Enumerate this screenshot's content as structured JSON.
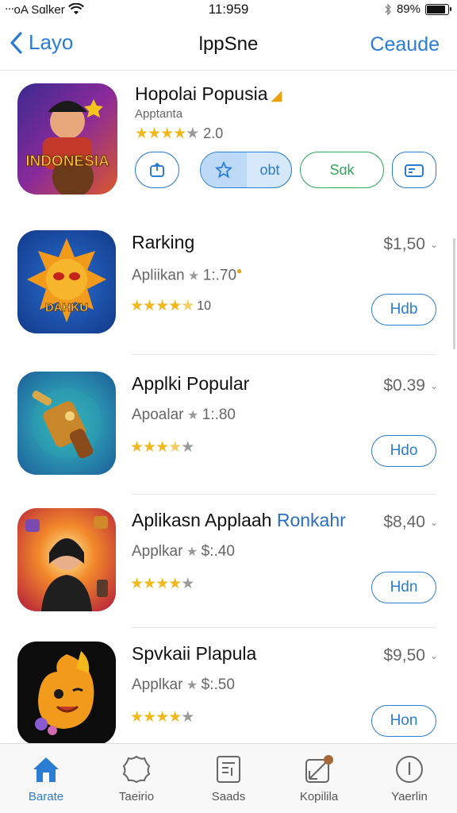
{
  "status_bar": {
    "carrier": "ᐧᐧᐧoA Sɑlker",
    "time": "11:959",
    "battery": "89%",
    "battery_level": 0.89
  },
  "nav": {
    "back_label": "Layo",
    "title": "lppSne",
    "action_label": "Ceaude"
  },
  "featured": {
    "title": "Hopolai Popusia",
    "subtitle": "Apptanta",
    "rating_value": "2.0",
    "stars": 4,
    "icon_text": "INDONESIA",
    "actions": {
      "star_label": "obt",
      "sale_label": "Sɑk"
    }
  },
  "apps": [
    {
      "name": "Rarking",
      "name_accent": "",
      "meta": "Apliikan",
      "meta_value": "1:.70",
      "rating_count": "10",
      "stars": 4.5,
      "price": "$1,50",
      "button_label": "Hdb",
      "icon_text": "DAHKU"
    },
    {
      "name": "Applki Popular",
      "name_accent": "",
      "meta": "Apoalar",
      "meta_value": "1:.80",
      "rating_count": "",
      "stars": 3.5,
      "price": "$0.39",
      "button_label": "Hdo",
      "icon_text": ""
    },
    {
      "name": "Aplikasn Applaah",
      "name_accent": "Ronkahr",
      "meta": "Applkar",
      "meta_value": "$:.40",
      "rating_count": "",
      "stars": 4,
      "price": "$8,40",
      "button_label": "Hdn",
      "icon_text": ""
    },
    {
      "name": "Spvkaii Plapula",
      "name_accent": "",
      "meta": "Applkar",
      "meta_value": "$:.50",
      "rating_count": "",
      "stars": 4,
      "price": "$9,50",
      "button_label": "Hon",
      "icon_text": ""
    }
  ],
  "tabs": [
    {
      "label": "Barate",
      "icon": "home-icon",
      "active": true
    },
    {
      "label": "Taeirio",
      "icon": "badge-icon",
      "active": false
    },
    {
      "label": "Saads",
      "icon": "list-icon",
      "active": false
    },
    {
      "label": "Kopilila",
      "icon": "chart-icon",
      "active": false
    },
    {
      "label": "Yaerlin",
      "icon": "info-icon",
      "active": false
    }
  ],
  "colors": {
    "accent": "#2b7cd3",
    "star": "#f2b81c",
    "sale": "#2eaa5b"
  }
}
